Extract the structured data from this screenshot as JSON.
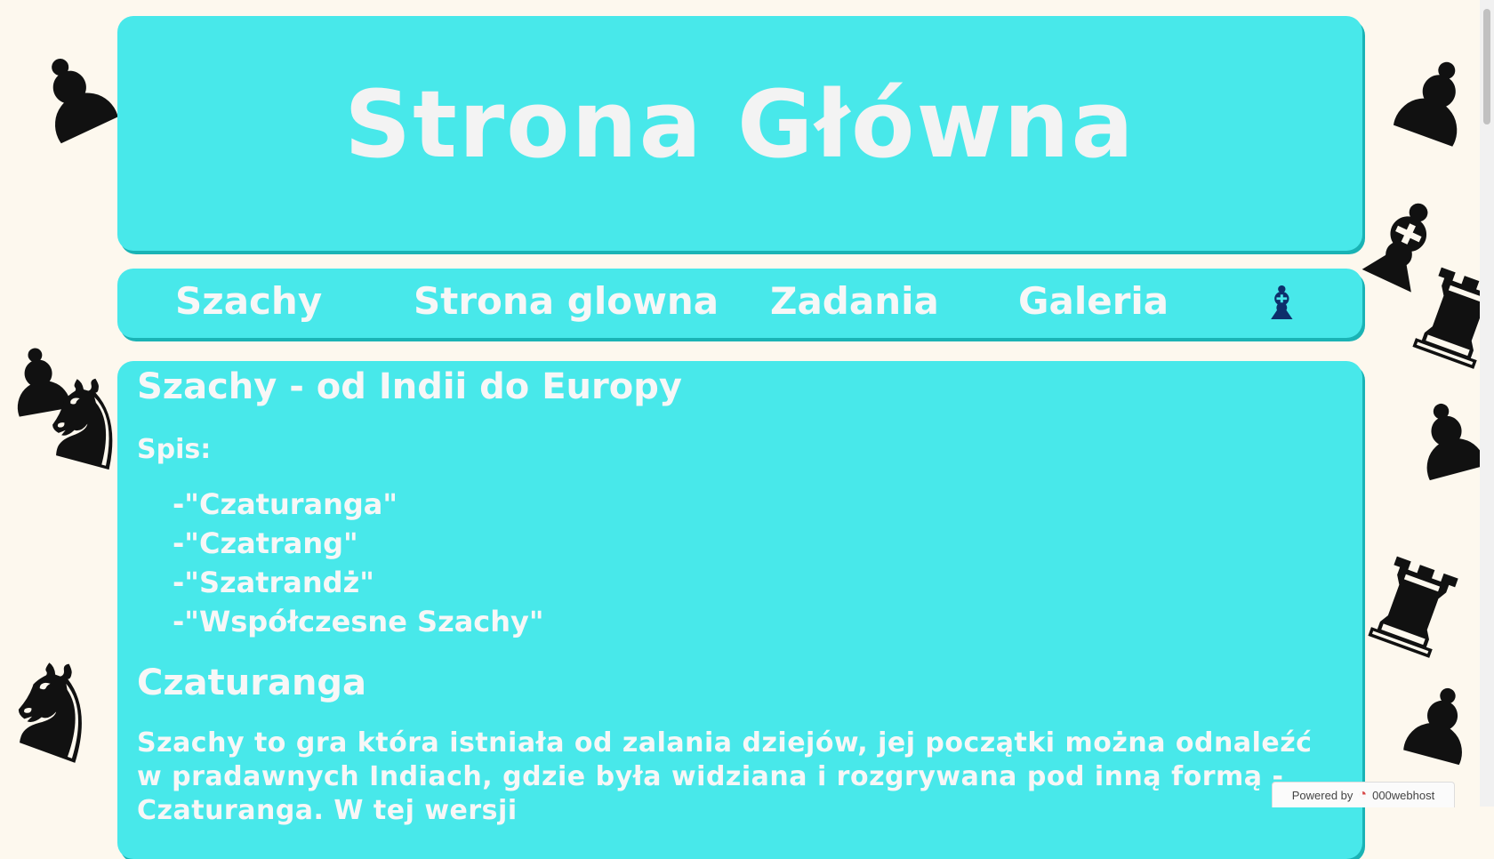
{
  "header": {
    "title": "Strona Główna"
  },
  "nav": {
    "items": [
      "Szachy",
      "Strona glowna",
      "Zadania",
      "Galeria"
    ],
    "icon": "bishop-icon"
  },
  "content": {
    "heading": "Szachy - od Indii do Europy",
    "spis_label": "Spis:",
    "toc": [
      "-\"Czaturanga\"",
      "-\"Czatrang\"",
      "-\"Szatrandż\"",
      "-\"Współczesne Szachy\""
    ],
    "section_title": "Czaturanga",
    "paragraph": "Szachy to gra która istniała od zalania dziejów, jej początki można odnaleźć w pradawnych Indiach, gdzie była widziana i rozgrywana pod inną formą - Czaturanga. W tej wersji"
  },
  "badge": {
    "powered_by": "Powered by",
    "host": "000webhost"
  },
  "colors": {
    "panel": "#48e8ea",
    "panel_shadow": "#1ab3b5",
    "background": "#fdf8ee",
    "text": "#f7f7f7"
  }
}
